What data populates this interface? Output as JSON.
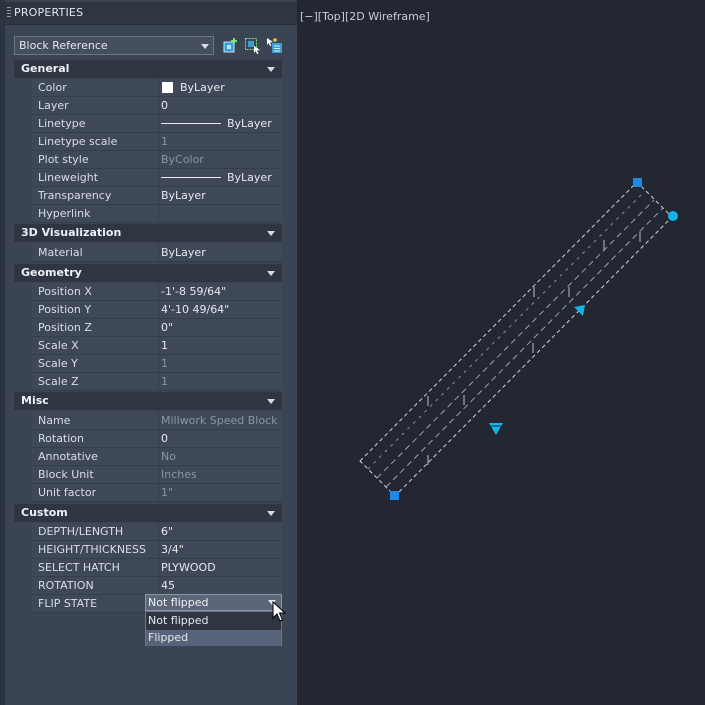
{
  "palette": {
    "title": "PROPERTIES",
    "selector": "Block Reference"
  },
  "sections": {
    "general": {
      "label": "General",
      "rows": [
        {
          "name": "Color",
          "value": "ByLayer"
        },
        {
          "name": "Layer",
          "value": "0"
        },
        {
          "name": "Linetype",
          "value": "ByLayer"
        },
        {
          "name": "Linetype scale",
          "value": "1"
        },
        {
          "name": "Plot style",
          "value": "ByColor"
        },
        {
          "name": "Lineweight",
          "value": "ByLayer"
        },
        {
          "name": "Transparency",
          "value": "ByLayer"
        },
        {
          "name": "Hyperlink",
          "value": ""
        }
      ]
    },
    "viz": {
      "label": "3D Visualization",
      "rows": [
        {
          "name": "Material",
          "value": "ByLayer"
        }
      ]
    },
    "geometry": {
      "label": "Geometry",
      "rows": [
        {
          "name": "Position X",
          "value": "-1'-8 59/64\""
        },
        {
          "name": "Position Y",
          "value": "4'-10 49/64\""
        },
        {
          "name": "Position Z",
          "value": "0\""
        },
        {
          "name": "Scale X",
          "value": "1"
        },
        {
          "name": "Scale Y",
          "value": "1"
        },
        {
          "name": "Scale Z",
          "value": "1"
        }
      ]
    },
    "misc": {
      "label": "Misc",
      "rows": [
        {
          "name": "Name",
          "value": "Millwork Speed Block"
        },
        {
          "name": "Rotation",
          "value": "0"
        },
        {
          "name": "Annotative",
          "value": "No"
        },
        {
          "name": "Block Unit",
          "value": "Inches"
        },
        {
          "name": "Unit factor",
          "value": "1\""
        }
      ]
    },
    "custom": {
      "label": "Custom",
      "rows": [
        {
          "name": "DEPTH/LENGTH",
          "value": "6\""
        },
        {
          "name": "HEIGHT/THICKNESS",
          "value": "3/4\""
        },
        {
          "name": "SELECT HATCH",
          "value": "PLYWOOD"
        },
        {
          "name": "ROTATION",
          "value": "45"
        },
        {
          "name": "FLIP STATE",
          "value": "Not flipped"
        }
      ]
    }
  },
  "dropdown": {
    "options": [
      "Not flipped",
      "Flipped"
    ],
    "highlighted": "Flipped"
  },
  "viewport": {
    "label": "[−][Top][2D Wireframe]"
  },
  "colors": {
    "grip": "#1e88e5",
    "grip_cyan": "#14b4e6",
    "panel_bg": "#3b4453",
    "canvas_bg": "#222732"
  },
  "icons": [
    "quick-select-icon",
    "select-objects-icon",
    "toggle-pickadd-icon"
  ]
}
